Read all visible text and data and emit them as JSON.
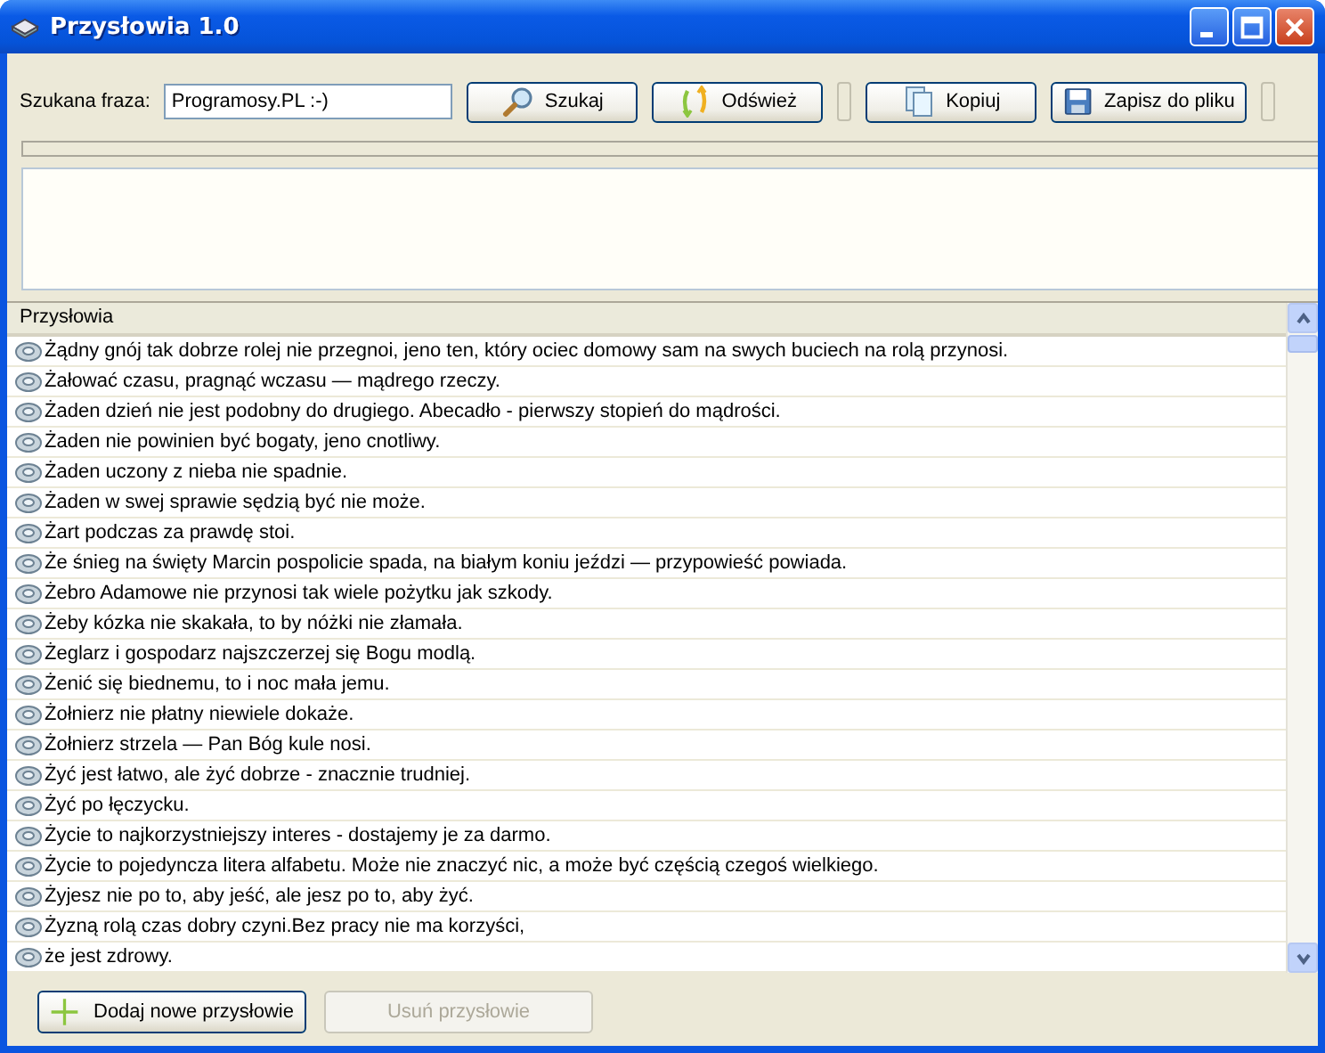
{
  "window": {
    "title": "Przysłowia 1.0"
  },
  "search": {
    "label": "Szukana fraza:",
    "value": "Programosy.PL :-)"
  },
  "toolbar": {
    "search_button": "Szukaj",
    "refresh_button": "Odśwież",
    "copy_button": "Kopiuj",
    "save_button": "Zapisz do pliku"
  },
  "progress": {
    "level": 0
  },
  "list": {
    "column": "Przysłowia",
    "rows": [
      "Żądny gnój tak dobrze rolej nie przegnoi, jeno ten, który ociec domowy sam na swych buciech na rolą przynosi.",
      "Żałować czasu, pragnąć wczasu — mądrego rzeczy.",
      "Żaden dzień nie jest podobny do drugiego. Abecadło - pierwszy stopień do mądrości.",
      "Żaden nie powinien być bogaty, jeno cnotliwy.",
      "Żaden uczony z nieba nie spadnie.",
      "Żaden w swej sprawie sędzią być nie może.",
      "Żart podczas za prawdę stoi.",
      "Że śnieg na święty Marcin pospolicie spada, na białym koniu jeździ — przypowieść powiada.",
      "Żebro Adamowe nie przynosi tak wiele pożytku jak szkody.",
      "Żeby kózka nie skakała, to by nóżki nie złamała.",
      "Żeglarz i gospodarz najszczerzej się Bogu modlą.",
      "Żenić się biednemu, to i noc mała jemu.",
      "Żołnierz nie płatny niewiele dokaże.",
      "Żołnierz strzela — Pan Bóg kule nosi.",
      "Żyć jest łatwo, ale żyć dobrze - znacznie trudniej.",
      "Żyć po łęczycku.",
      "Życie to najkorzystniejszy interes - dostajemy je za darmo.",
      "Życie to pojedyncza litera alfabetu. Może nie znaczyć nic, a może być częścią czegoś wielkiego.",
      "Żyjesz nie po to, aby jeść, ale jesz po to, aby żyć.",
      "Żyzną rolą czas dobry czyni.Bez pracy nie ma korzyści,",
      "że jest zdrowy."
    ]
  },
  "bottom_buttons": [
    {
      "kind": "add",
      "label": "Dodaj nowe przysłowie",
      "disabled": false
    },
    {
      "kind": "remove",
      "label": "Usuń przysłowie",
      "disabled": true
    }
  ]
}
